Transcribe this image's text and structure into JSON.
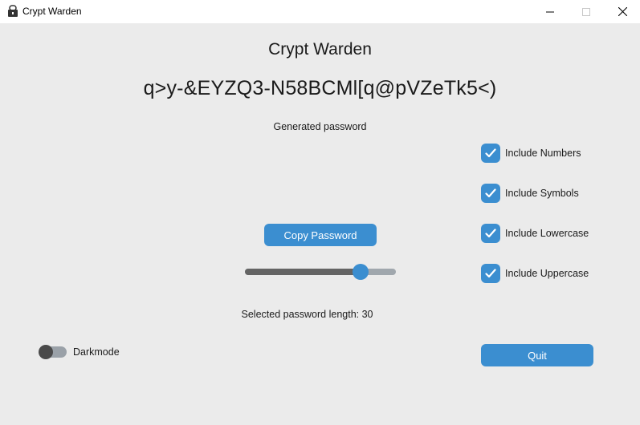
{
  "window": {
    "title": "Crypt Warden",
    "icons": {
      "app": "vault-icon",
      "minimize": "minimize-icon",
      "maximize": "maximize-icon",
      "close": "close-icon"
    }
  },
  "app": {
    "heading": "Crypt Warden",
    "password": "q>y-&EYZQ3-N58BCMl[q@pVZeTk5<)",
    "generated_label": "Generated password",
    "copy_button": "Copy Password",
    "length_label": "Selected password length: 30",
    "slider_value_fraction": 0.8,
    "accent_color": "#3b8ed0"
  },
  "options": [
    {
      "label": "Include Numbers",
      "checked": true
    },
    {
      "label": "Include Symbols",
      "checked": true
    },
    {
      "label": "Include Lowercase",
      "checked": true
    },
    {
      "label": "Include Uppercase",
      "checked": true
    }
  ],
  "darkmode": {
    "label": "Darkmode",
    "enabled": false
  },
  "quit_button": "Quit"
}
